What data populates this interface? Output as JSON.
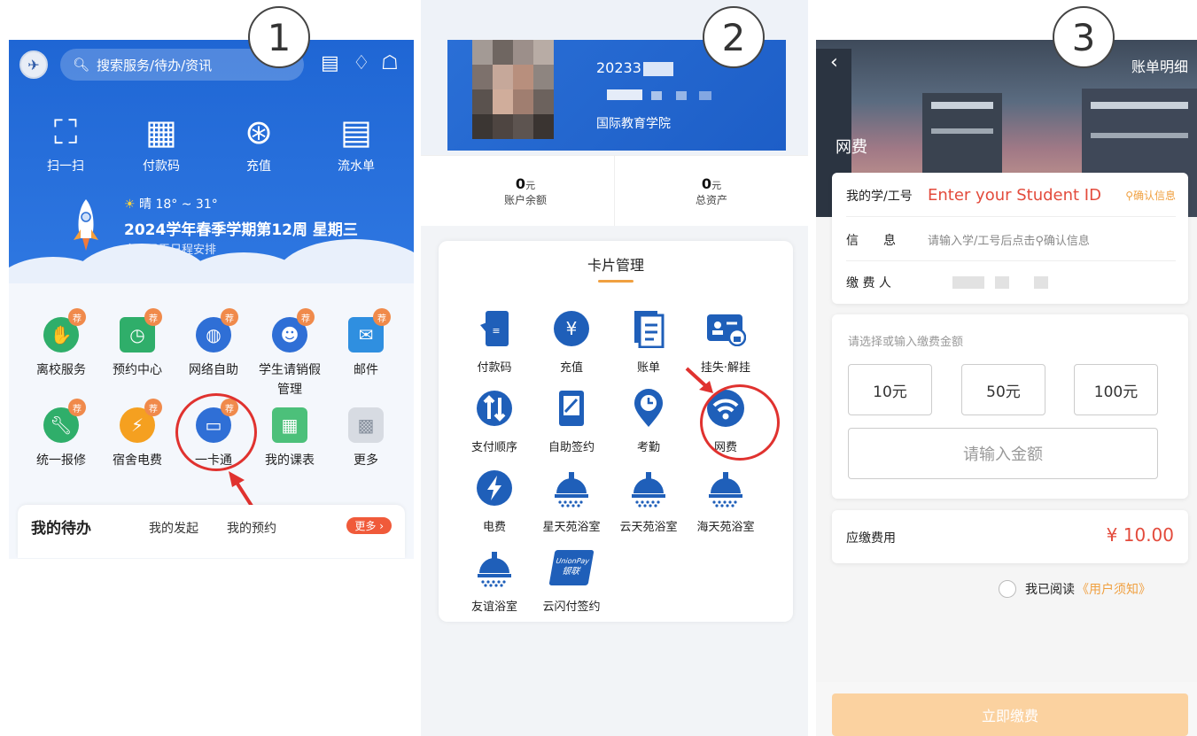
{
  "steps": [
    "1",
    "2",
    "3"
  ],
  "panel1": {
    "search_placeholder": "搜索服务/待办/资讯",
    "quick_actions": [
      "扫一扫",
      "付款码",
      "充值",
      "流水单"
    ],
    "weather": "晴 18° ~ 31°",
    "semester": "2024学年春季学期第12周 星期三",
    "no_schedule": "今天已无日程安排",
    "tag_label": "荐",
    "services_row1": [
      "离校服务",
      "预约中心",
      "网络自助",
      "学生请销假",
      "管理",
      "邮件"
    ],
    "services_row2": [
      "统一报修",
      "宿舍电费",
      "一卡通",
      "我的课表",
      "更多"
    ],
    "todo_title": "我的待办",
    "todo_tabs": [
      "我的发起",
      "我的预约"
    ],
    "more_label": "更多",
    "colors": {
      "primary": "#2a6fd6",
      "highlight": "#e0322f",
      "tag": "#f08a4b"
    }
  },
  "panel2": {
    "student_id_prefix": "20233",
    "college": "国际教育学院",
    "balance_value": "0",
    "balance_unit": "元",
    "balance_label": "账户余额",
    "assets_value": "0",
    "assets_unit": "元",
    "assets_label": "总资产",
    "manage_title": "卡片管理",
    "items": [
      "付款码",
      "充值",
      "账单",
      "挂失·解挂",
      "支付顺序",
      "自助签约",
      "考勤",
      "网费",
      "电费",
      "星天苑浴室",
      "云天苑浴室",
      "海天苑浴室",
      "友谊浴室",
      "云闪付签约"
    ],
    "unionpay_line1": "UnionPay",
    "unionpay_line2": "银联"
  },
  "panel3": {
    "bill_detail": "账单明细",
    "title": "网费",
    "id_label": "我的学/工号",
    "id_value": "Enter your Student ID",
    "confirm_label": "确认信息",
    "info_label": "信　　息",
    "info_placeholder": "请输入学/工号后点击",
    "info_confirm": "确认信息",
    "payer_label": "缴 费 人",
    "amount_hint": "请选择或输入缴费金额",
    "amounts": [
      "10元",
      "50元",
      "100元"
    ],
    "amount_placeholder": "请输入金额",
    "fee_label": "应缴费用",
    "fee_value": "¥ 10.00",
    "agree_text": "我已阅读",
    "agree_link": "《用户须知》",
    "pay_button": "立即缴费"
  }
}
